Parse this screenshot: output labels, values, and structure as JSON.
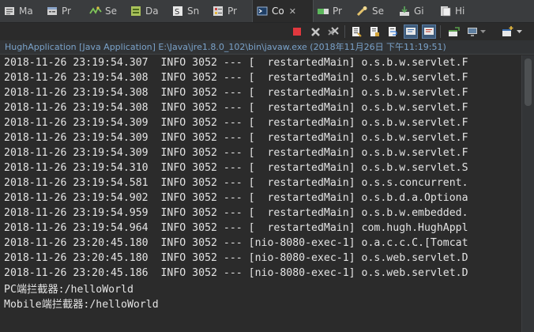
{
  "tabs": [
    {
      "label": "Ma",
      "icon": "markers-icon",
      "active": false,
      "closable": false
    },
    {
      "label": "Pr",
      "icon": "properties-icon",
      "active": false,
      "closable": false
    },
    {
      "label": "Se",
      "icon": "servers-icon",
      "active": false,
      "closable": false
    },
    {
      "label": "Da",
      "icon": "data-source-explorer-icon",
      "active": false,
      "closable": false
    },
    {
      "label": "Sn",
      "icon": "snippets-icon",
      "active": false,
      "closable": false
    },
    {
      "label": "Pr",
      "icon": "problems-icon",
      "active": false,
      "closable": false
    },
    {
      "label": "Co",
      "icon": "console-icon",
      "active": true,
      "closable": true,
      "close_symbol": "✕"
    },
    {
      "label": "Pr",
      "icon": "progress-icon",
      "active": false,
      "closable": false
    },
    {
      "label": "Se",
      "icon": "search-icon",
      "active": false,
      "closable": false
    },
    {
      "label": "Gi",
      "icon": "git-staging-icon",
      "active": false,
      "closable": false
    },
    {
      "label": "Hi",
      "icon": "history-icon",
      "active": false,
      "closable": false
    }
  ],
  "toolbar": {
    "buttons": [
      {
        "name": "terminate-button",
        "icon": "terminate-icon"
      },
      {
        "name": "remove-launch-button",
        "icon": "remove-launch-icon"
      },
      {
        "name": "remove-all-terminated-button",
        "icon": "remove-all-terminated-icon"
      },
      {
        "name": "clear-console-button",
        "icon": "clear-console-icon"
      },
      {
        "name": "scroll-lock-button",
        "icon": "scroll-lock-icon"
      },
      {
        "name": "word-wrap-button",
        "icon": "word-wrap-icon"
      },
      {
        "name": "show-on-stdout-button",
        "icon": "show-stdout-icon",
        "pressed": true
      },
      {
        "name": "show-on-stderr-button",
        "icon": "show-stderr-icon",
        "pressed": true
      },
      {
        "name": "pin-console-button",
        "icon": "pin-icon"
      },
      {
        "name": "display-console-button",
        "icon": "monitor-icon"
      },
      {
        "name": "open-console-button",
        "icon": "new-console-icon"
      }
    ]
  },
  "launch": {
    "description": "HughApplication [Java Application] E:\\Java\\jre1.8.0_102\\bin\\javaw.exe (2018年11月26日 下午11:19:51)"
  },
  "console": {
    "lines": [
      "2018-11-26 23:19:54.307  INFO 3052 --- [  restartedMain] o.s.b.w.servlet.F",
      "2018-11-26 23:19:54.308  INFO 3052 --- [  restartedMain] o.s.b.w.servlet.F",
      "2018-11-26 23:19:54.308  INFO 3052 --- [  restartedMain] o.s.b.w.servlet.F",
      "2018-11-26 23:19:54.308  INFO 3052 --- [  restartedMain] o.s.b.w.servlet.F",
      "2018-11-26 23:19:54.309  INFO 3052 --- [  restartedMain] o.s.b.w.servlet.F",
      "2018-11-26 23:19:54.309  INFO 3052 --- [  restartedMain] o.s.b.w.servlet.F",
      "2018-11-26 23:19:54.309  INFO 3052 --- [  restartedMain] o.s.b.w.servlet.F",
      "2018-11-26 23:19:54.310  INFO 3052 --- [  restartedMain] o.s.b.w.servlet.S",
      "2018-11-26 23:19:54.581  INFO 3052 --- [  restartedMain] o.s.s.concurrent.",
      "2018-11-26 23:19:54.902  INFO 3052 --- [  restartedMain] o.s.b.d.a.Optiona",
      "2018-11-26 23:19:54.959  INFO 3052 --- [  restartedMain] o.s.b.w.embedded.",
      "2018-11-26 23:19:54.964  INFO 3052 --- [  restartedMain] com.hugh.HughAppl",
      "2018-11-26 23:20:45.180  INFO 3052 --- [nio-8080-exec-1] o.a.c.c.C.[Tomcat",
      "2018-11-26 23:20:45.180  INFO 3052 --- [nio-8080-exec-1] o.s.web.servlet.D",
      "2018-11-26 23:20:45.186  INFO 3052 --- [nio-8080-exec-1] o.s.web.servlet.D",
      "PC端拦截器:/helloWorld",
      "Mobile端拦截器:/helloWorld"
    ]
  },
  "colors": {
    "background": "#2b2b2b",
    "text": "#e3e3e3",
    "launch_text": "#7aa2c9",
    "tab_bar": "#3a3c3e"
  }
}
